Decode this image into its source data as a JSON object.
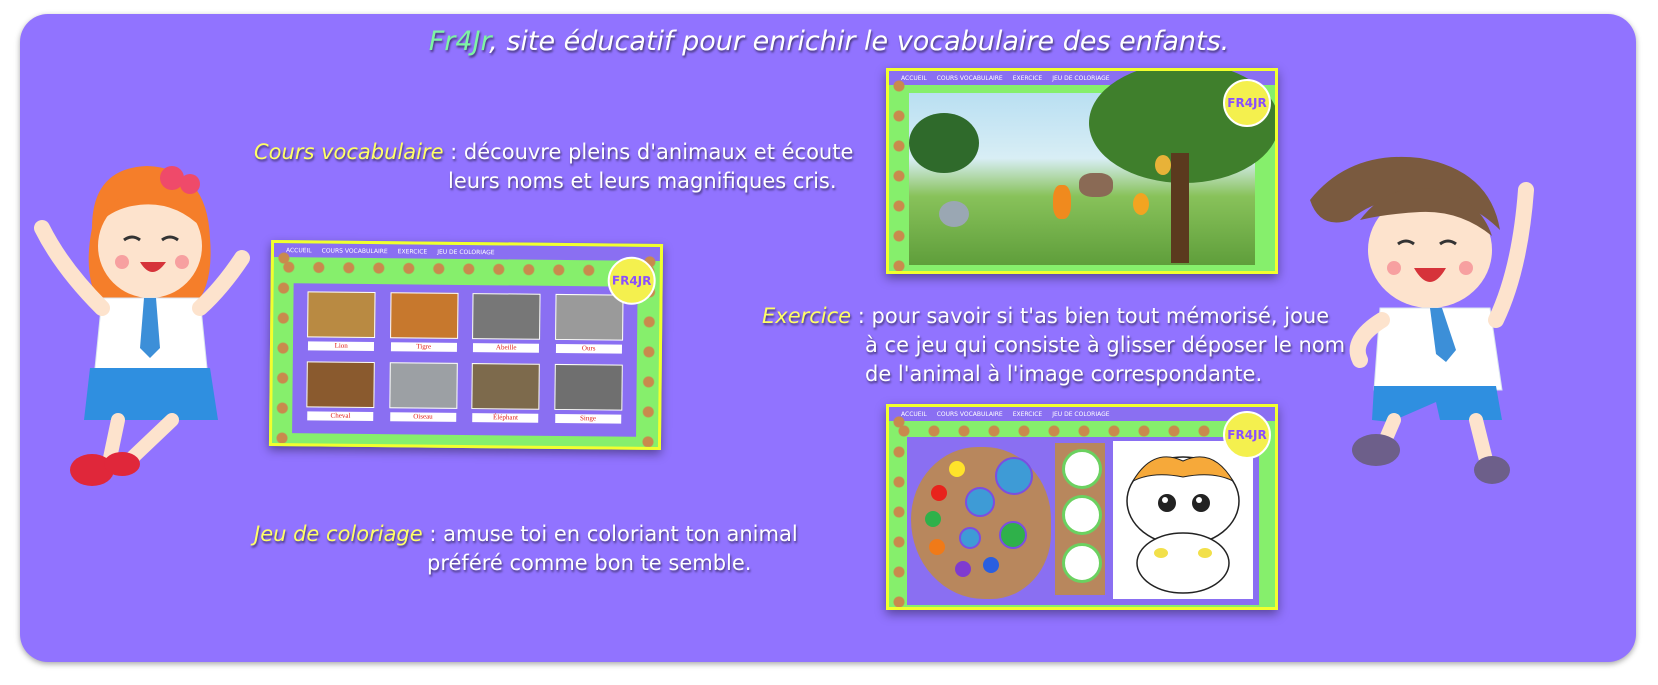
{
  "header": {
    "brand": "Fr4Jr",
    "tagline": ", site éducatif pour enrichir le vocabulaire des enfants."
  },
  "sections": {
    "cours": {
      "label": "Cours vocabulaire",
      "line1": " : découvre pleins d'animaux et écoute",
      "line2": "leurs noms et leurs magnifiques cris."
    },
    "exercice": {
      "label": "Exercice",
      "line1": " :  pour savoir si t'as bien tout mémorisé, joue",
      "line2": "à ce jeu qui consiste à glisser déposer le nom",
      "line3": "de l'animal à l'image correspondante."
    },
    "coloriage": {
      "label": "Jeu de coloriage",
      "line1": " : amuse toi en coloriant ton animal",
      "line2": "préféré comme bon te semble."
    }
  },
  "thumb_nav": [
    "ACCUEIL",
    "COURS VOCABULAIRE",
    "EXERCICE",
    "JEU DE COLORIAGE"
  ],
  "logo_text": "FR4JR",
  "vocab_cards": [
    {
      "name": "Lion",
      "color": "#b98a42"
    },
    {
      "name": "Tigre",
      "color": "#c7782d"
    },
    {
      "name": "Abeille",
      "color": "#777777"
    },
    {
      "name": "Ours",
      "color": "#9a9a9a"
    },
    {
      "name": "Cheval",
      "color": "#8a5a2e"
    },
    {
      "name": "Oiseau",
      "color": "#9ca0a4"
    },
    {
      "name": "Éléphant",
      "color": "#7d6a4c"
    },
    {
      "name": "Singe",
      "color": "#6f6f6f"
    }
  ],
  "colors": {
    "panel": "#9173ff",
    "brand": "#7ef5a4",
    "label": "#ffff66",
    "thumb_border": "#f2ff2e",
    "thumb_bg": "#86ef6c"
  },
  "icons": {
    "girl": "girl-character-illustration",
    "boy": "boy-character-illustration"
  }
}
